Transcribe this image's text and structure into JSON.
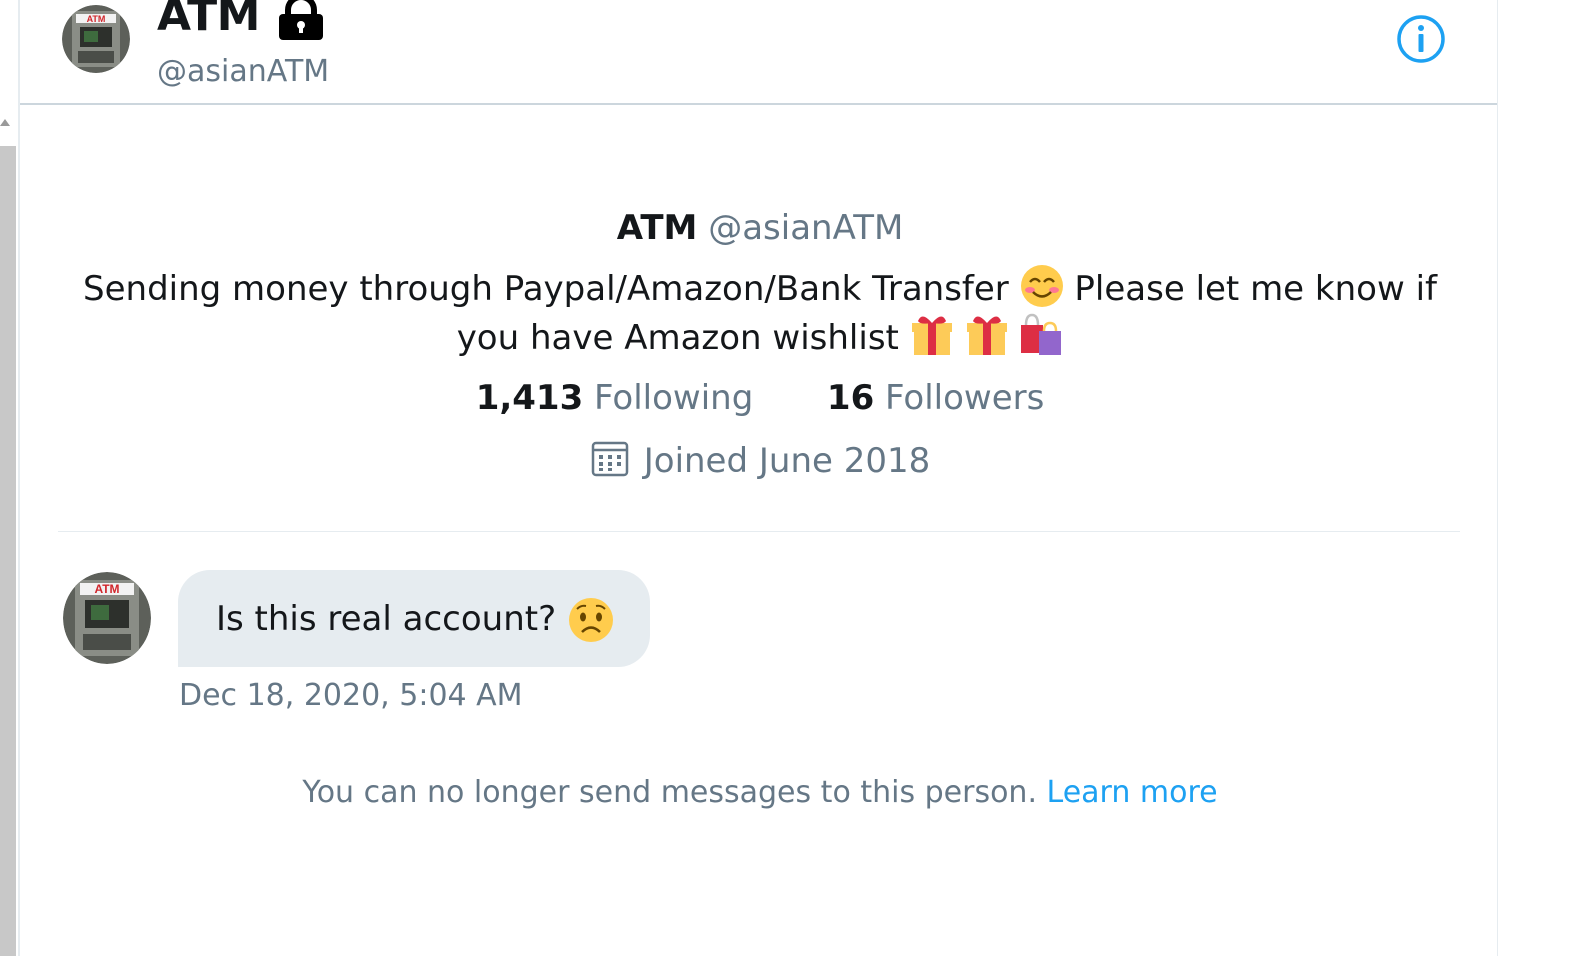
{
  "header": {
    "name": "ATM",
    "handle": "@asianATM",
    "protected_icon": "lock-icon",
    "info_icon": "info-icon"
  },
  "profile": {
    "name": "ATM",
    "handle": "@asianATM",
    "bio_part1": "Sending money through Paypal/Amazon/Bank Transfer",
    "bio_part2": "Please let me know if you have Amazon wishlist",
    "following_count": "1,413",
    "following_label": "Following",
    "followers_count": "16",
    "followers_label": "Followers",
    "joined": "Joined June 2018"
  },
  "message": {
    "text": "Is this real account?",
    "timestamp": "Dec 18, 2020, 5:04 AM",
    "emoji": "worried-face"
  },
  "notice": {
    "text": "You can no longer send messages to this person.",
    "link": "Learn more"
  },
  "colors": {
    "accent": "#1da1f2",
    "secondary_text": "#657786",
    "bubble": "#e6ecf0"
  }
}
